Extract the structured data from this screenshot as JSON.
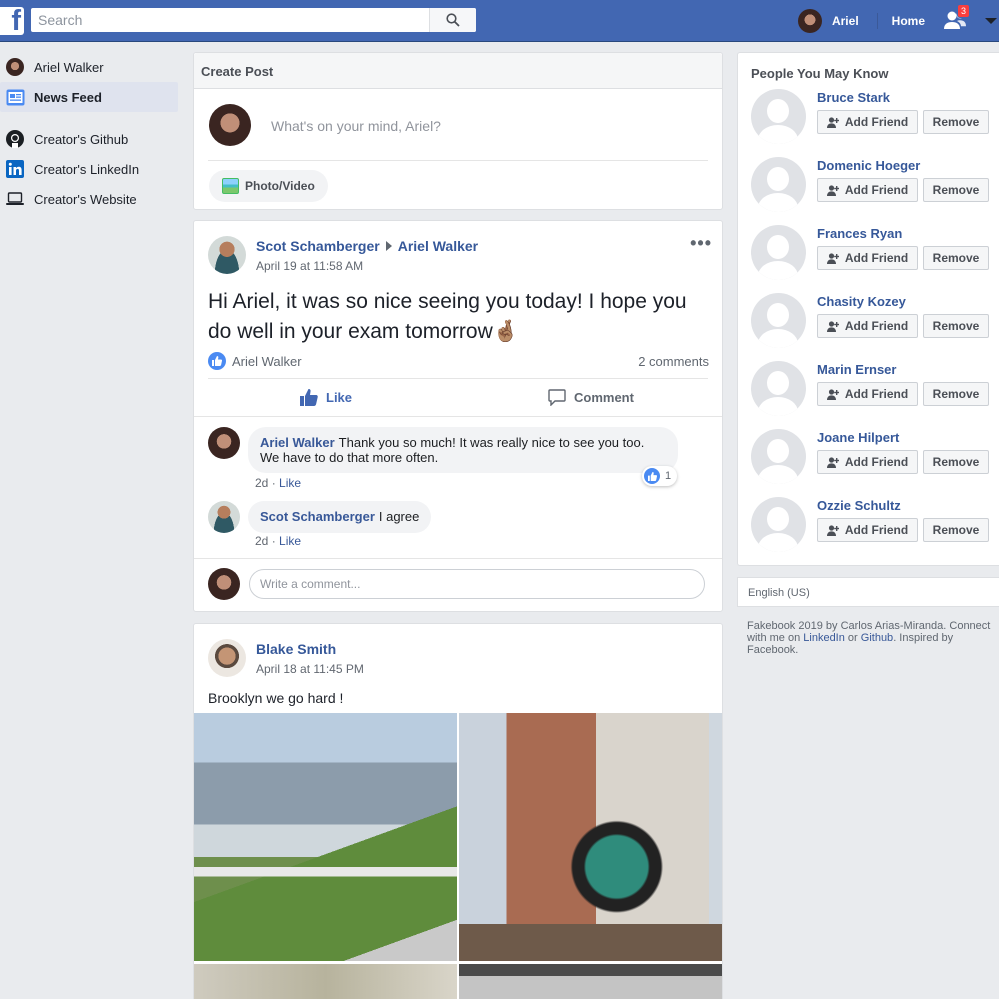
{
  "topbar": {
    "logo": "f",
    "search_placeholder": "Search",
    "user_name": "Ariel",
    "home_label": "Home",
    "friend_requests_count": "3",
    "brand_color": "#4267b2"
  },
  "sidebar": {
    "items": [
      {
        "label": "Ariel Walker",
        "icon": "avatar"
      },
      {
        "label": "News Feed",
        "icon": "news-feed-icon",
        "active": true
      },
      {
        "label": "Creator's Github",
        "icon": "github-icon"
      },
      {
        "label": "Creator's LinkedIn",
        "icon": "linkedin-icon"
      },
      {
        "label": "Creator's Website",
        "icon": "laptop-icon"
      }
    ]
  },
  "create_post": {
    "title": "Create Post",
    "placeholder": "What's on your mind, Ariel?",
    "photo_button": "Photo/Video"
  },
  "posts": [
    {
      "author": "Scot Schamberger",
      "target": "Ariel Walker",
      "time": "April 19 at 11:58 AM",
      "text": "Hi Ariel, it was so nice seeing you today! I hope you do well in your exam tomorrow🤞🏽",
      "liked_by": "Ariel Walker",
      "comments_count": "2 comments",
      "like_label": "Like",
      "comment_label": "Comment",
      "comments": [
        {
          "author": "Ariel Walker",
          "text": "Thank you so much! It was really nice to see you too. We have to do that more often.",
          "age": "2d",
          "like": "Like",
          "reactions": "1"
        },
        {
          "author": "Scot Schamberger",
          "text": "I agree",
          "age": "2d",
          "like": "Like"
        }
      ],
      "write_placeholder": "Write a comment..."
    },
    {
      "author": "Blake Smith",
      "time": "April 18 at 11:45 PM",
      "text": "Brooklyn we go hard !"
    }
  ],
  "pymk": {
    "title": "People You May Know",
    "add_label": "Add Friend",
    "remove_label": "Remove",
    "people": [
      "Bruce Stark",
      "Domenic Hoeger",
      "Frances Ryan",
      "Chasity Kozey",
      "Marin Ernser",
      "Joane Hilpert",
      "Ozzie Schultz"
    ]
  },
  "language": "English (US)",
  "footer": {
    "prefix": "Fakebook 2019 by Carlos Arias-Miranda. Connect with me on",
    "linkedin": "LinkedIn",
    "or": "or",
    "github": "Github",
    "suffix": ". Inspired by Facebook."
  }
}
